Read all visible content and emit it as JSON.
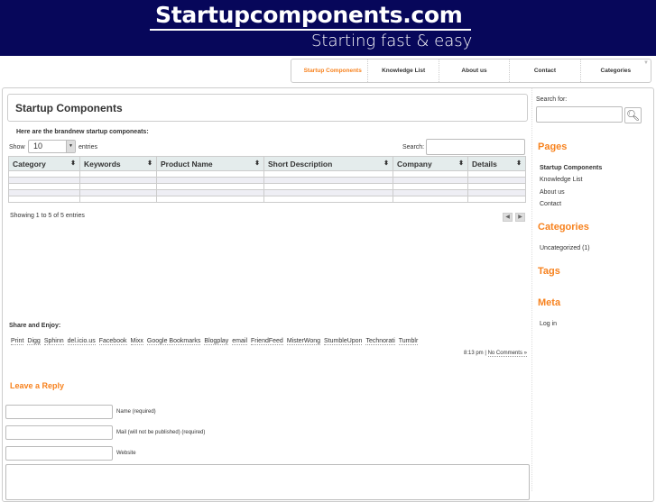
{
  "header": {
    "logo": "Startupcomponents.com",
    "tagline": "Starting fast & easy"
  },
  "nav": {
    "items": [
      "Startup Components",
      "Knowledge List",
      "About us",
      "Contact",
      "Categories"
    ]
  },
  "page": {
    "title": "Startup Components",
    "intro": "Here are the brandnew startup componeats:"
  },
  "table": {
    "show_label": "Show",
    "entries_label": "entries",
    "page_size": "10",
    "search_label": "Search:",
    "columns": [
      "Category",
      "Keywords",
      "Product Name",
      "Short Description",
      "Company",
      "Details"
    ],
    "row_count": 5,
    "info": "Showing 1 to 5 of 5 entries",
    "prev": "◀",
    "next": "▶"
  },
  "share": {
    "title": "Share and Enjoy:",
    "links": [
      "Print",
      "Digg",
      "Sphinn",
      "del.icio.us",
      "Facebook",
      "Mixx",
      "Google Bookmarks",
      "Blogplay",
      "email",
      "FriendFeed",
      "MisterWong",
      "StumbleUpon",
      "Technorati",
      "Tumblr"
    ]
  },
  "meta": {
    "time": "8:13 pm",
    "sep": "|",
    "comments": "No Comments »"
  },
  "reply": {
    "title": "Leave a Reply",
    "name_label": "Name (required)",
    "mail_label": "Mail (will not be published) (required)",
    "website_label": "Website"
  },
  "sidebar": {
    "search_label": "Search for:",
    "pages_title": "Pages",
    "pages": [
      "Startup Components",
      "Knowledge List",
      "About us",
      "Contact"
    ],
    "categories_title": "Categories",
    "categories": [
      "Uncategorized (1)"
    ],
    "tags_title": "Tags",
    "meta_title": "Meta",
    "meta_links": [
      "Log in"
    ]
  }
}
